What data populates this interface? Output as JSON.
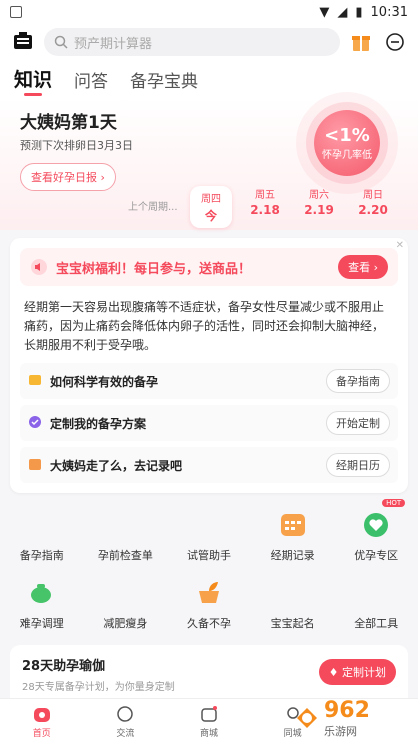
{
  "status": {
    "time": "10:31"
  },
  "search": {
    "placeholder": "预产期计算器"
  },
  "tabs": [
    "知识",
    "问答",
    "备孕宝典"
  ],
  "hero": {
    "title": "大姨妈第1天",
    "subtitle": "预测下次排卵日3月3日",
    "button": "查看好孕日报 ›",
    "ring_big": "<1%",
    "ring_small": "怀孕几率低",
    "prev_label": "上个周期...",
    "days": [
      {
        "dow": "周四",
        "num": "今"
      },
      {
        "dow": "周五",
        "num": "2.18"
      },
      {
        "dow": "周六",
        "num": "2.19"
      },
      {
        "dow": "周日",
        "num": "2.20"
      }
    ]
  },
  "promo": {
    "text": "宝宝树福利！每日参与，送商品！",
    "button": "查看 ›"
  },
  "paragraph": "经期第一天容易出现腹痛等不适症状，备孕女性尽量减少或不服用止痛药，因为止痛药会降低体内卵子的活性，同时还会抑制大脑神经，长期服用不利于受孕哦。",
  "rows": [
    {
      "label": "如何科学有效的备孕",
      "button": "备孕指南"
    },
    {
      "label": "定制我的备孕方案",
      "button": "开始定制"
    },
    {
      "label": "大姨妈走了么，去记录吧",
      "button": "经期日历"
    }
  ],
  "tools": [
    {
      "label": "备孕指南"
    },
    {
      "label": "孕前检查单"
    },
    {
      "label": "试管助手"
    },
    {
      "label": "经期记录"
    },
    {
      "label": "优孕专区",
      "badge": "HOT"
    },
    {
      "label": "难孕调理"
    },
    {
      "label": "减肥瘦身"
    },
    {
      "label": "久备不孕"
    },
    {
      "label": "宝宝起名"
    },
    {
      "label": "全部工具"
    }
  ],
  "yoga": {
    "title": "28天助孕瑜伽",
    "subtitle": "28天专属备孕计划，为你量身定制",
    "button": "定制计划"
  },
  "bottom_nav": [
    "首页",
    "交流",
    "商城",
    "同城"
  ],
  "watermark": {
    "brand": "962",
    "sub": "乐游网"
  },
  "colors": {
    "accent": "#f44a5c"
  }
}
